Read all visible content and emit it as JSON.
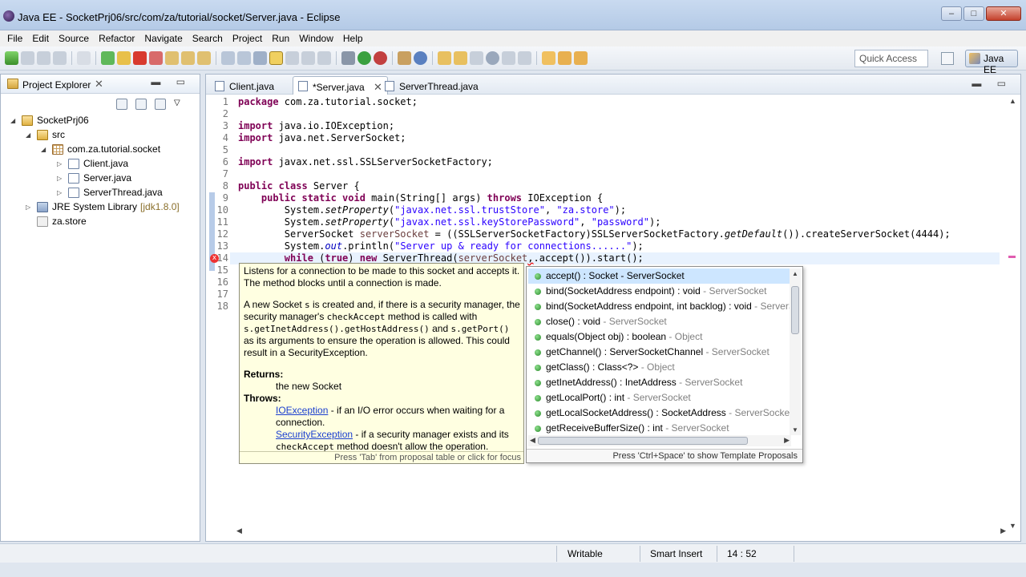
{
  "window": {
    "title": "Java EE - SocketPrj06/src/com/za/tutorial/socket/Server.java - Eclipse",
    "buttons": [
      "–",
      "□",
      "✕"
    ]
  },
  "menu": [
    "File",
    "Edit",
    "Source",
    "Refactor",
    "Navigate",
    "Search",
    "Project",
    "Run",
    "Window",
    "Help"
  ],
  "toolbar": {
    "quick_access": "Quick Access",
    "perspective": "Java EE"
  },
  "explorer": {
    "title": "Project Explorer",
    "close": "✕",
    "minmax": "▬ ▭",
    "tree": [
      {
        "label": "SocketPrj06",
        "twisty": "◢",
        "icon": "proj"
      },
      {
        "label": "src",
        "twisty": "◢",
        "icon": "srcf"
      },
      {
        "label": "com.za.tutorial.socket",
        "twisty": "◢",
        "icon": "pkg"
      },
      {
        "label": "Client.java",
        "twisty": "▷",
        "icon": "jfile"
      },
      {
        "label": "Server.java",
        "twisty": "▷",
        "icon": "jfile"
      },
      {
        "label": "ServerThread.java",
        "twisty": "▷",
        "icon": "jfile"
      },
      {
        "label": "JRE System Library",
        "suffix": "[jdk1.8.0]",
        "twisty": "▷",
        "icon": "lib"
      },
      {
        "label": "za.store",
        "twisty": "",
        "icon": "store"
      }
    ]
  },
  "editor": {
    "tabs": [
      {
        "label": "Client.java",
        "close": ""
      },
      {
        "label": "*Server.java",
        "close": "✕"
      },
      {
        "label": "ServerThread.java",
        "close": ""
      }
    ],
    "minmax": "▬ ▭",
    "line_numbers": [
      "1",
      "2",
      "3",
      "4",
      "5",
      "6",
      "7",
      "8",
      "9",
      "10",
      "11",
      "12",
      "13",
      "14",
      "15",
      "16",
      "17",
      "18"
    ]
  },
  "javadoc": {
    "p1": "Listens for a connection to be made to this socket and accepts it. The method blocks until a connection is made.",
    "p2_a": "A new Socket ",
    "p2_s": "s",
    "p2_b": " is created and, if there is a security manager, the security manager's ",
    "p2_c": "checkAccept",
    "p2_d": " method is called with ",
    "p2_e": "s.getInetAddress().getHostAddress()",
    "p2_f": " and ",
    "p2_g": "s.getPort()",
    "p2_h": " as its arguments to ensure the operation is allowed. This could result in a SecurityException.",
    "returns_label": "Returns:",
    "returns_text": "the new Socket",
    "throws_label": "Throws:",
    "ioexc": "IOException",
    "ioexc_text": " - if an I/O error occurs when waiting for a connection.",
    "secexc": "SecurityException",
    "secexc_text": " - if a security manager exists and its ",
    "secexc_code": "checkAccept",
    "secexc_text2": " method doesn't allow the operation.",
    "footer": "Press 'Tab' from proposal table or click for focus"
  },
  "proposals": {
    "items": [
      {
        "sig": "accept() : Socket - ServerSocket",
        "owner": ""
      },
      {
        "sig": "bind(SocketAddress endpoint) : void",
        "owner": " - ServerSocket"
      },
      {
        "sig": "bind(SocketAddress endpoint, int backlog) : void",
        "owner": " - ServerS"
      },
      {
        "sig": "close() : void",
        "owner": " - ServerSocket"
      },
      {
        "sig": "equals(Object obj) : boolean",
        "owner": " - Object"
      },
      {
        "sig": "getChannel() : ServerSocketChannel",
        "owner": " - ServerSocket"
      },
      {
        "sig": "getClass() : Class<?>",
        "owner": " - Object"
      },
      {
        "sig": "getInetAddress() : InetAddress",
        "owner": " - ServerSocket"
      },
      {
        "sig": "getLocalPort() : int",
        "owner": " - ServerSocket"
      },
      {
        "sig": "getLocalSocketAddress() : SocketAddress",
        "owner": " - ServerSocket"
      },
      {
        "sig": "getReceiveBufferSize() : int",
        "owner": " - ServerSocket"
      }
    ],
    "footer": "Press 'Ctrl+Space' to show Template Proposals"
  },
  "status": {
    "writable": "Writable",
    "insert": "Smart Insert",
    "position": "14 : 52"
  },
  "colors": {
    "keyword": "#7f0055",
    "string": "#2a00ff",
    "field": "#0000c0",
    "selection": "#cde6ff",
    "javadoc_bg": "#ffffe1"
  }
}
